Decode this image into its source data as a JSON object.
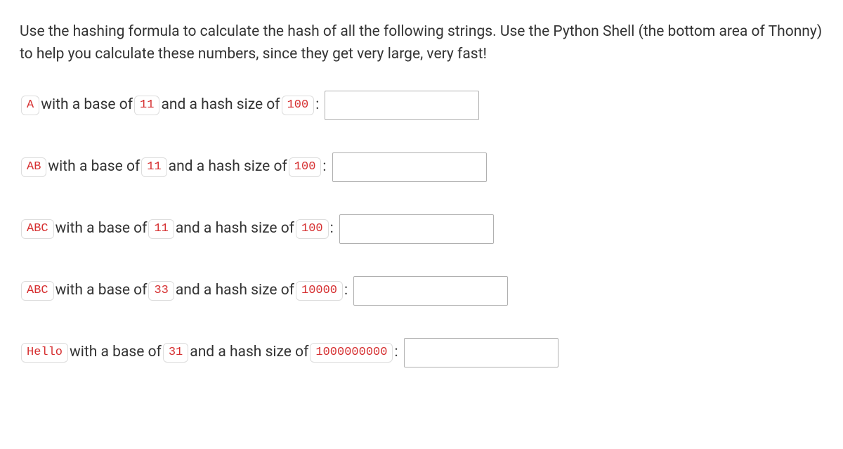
{
  "instructions": "Use the hashing formula to calculate the hash of all the following strings. Use the Python Shell (the bottom area of Thonny) to help you calculate these numbers, since they get very large, very fast!",
  "text": {
    "with_base": " with a base of ",
    "and_hash": " and a hash size of ",
    "colon": ":"
  },
  "questions": [
    {
      "string": "A",
      "base": "11",
      "hash_size": "100"
    },
    {
      "string": "AB",
      "base": "11",
      "hash_size": "100"
    },
    {
      "string": "ABC",
      "base": "11",
      "hash_size": "100"
    },
    {
      "string": "ABC",
      "base": "33",
      "hash_size": "10000"
    },
    {
      "string": "Hello",
      "base": "31",
      "hash_size": "1000000000"
    }
  ]
}
